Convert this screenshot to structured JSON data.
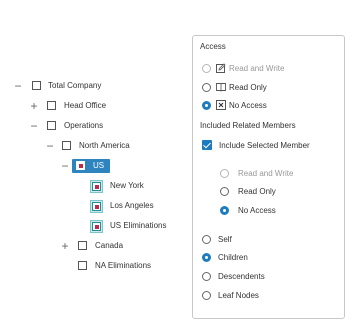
{
  "tree": {
    "nodes": [
      {
        "label": "Total Company",
        "expander": "−"
      },
      {
        "label": "Head Office",
        "expander": "+"
      },
      {
        "label": "Operations",
        "expander": "−"
      },
      {
        "label": "North America",
        "expander": "−"
      },
      {
        "label": "US",
        "expander": "−"
      },
      {
        "label": "New York"
      },
      {
        "label": "Los Angeles"
      },
      {
        "label": "US Eliminations"
      },
      {
        "label": "Canada",
        "expander": "+"
      },
      {
        "label": "NA Eliminations"
      }
    ]
  },
  "panel": {
    "access": {
      "title": "Access",
      "options": [
        {
          "label": "Read and Write",
          "state": "disabled",
          "icon": "edit-icon"
        },
        {
          "label": "Read Only",
          "state": "unchecked",
          "icon": "book-icon"
        },
        {
          "label": "No Access",
          "state": "checked",
          "icon": "no-access-icon"
        }
      ]
    },
    "related": {
      "title": "Included Related Members",
      "include_label": "Include Selected Member",
      "include_checked": true,
      "sub_options": [
        {
          "label": "Read and Write",
          "state": "disabled"
        },
        {
          "label": "Read Only",
          "state": "unchecked"
        },
        {
          "label": "No Access",
          "state": "checked"
        }
      ],
      "scope_options": [
        {
          "label": "Self",
          "state": "unchecked"
        },
        {
          "label": "Children",
          "state": "checked"
        },
        {
          "label": "Descendents",
          "state": "unchecked"
        },
        {
          "label": "Leaf Nodes",
          "state": "unchecked"
        }
      ]
    }
  }
}
